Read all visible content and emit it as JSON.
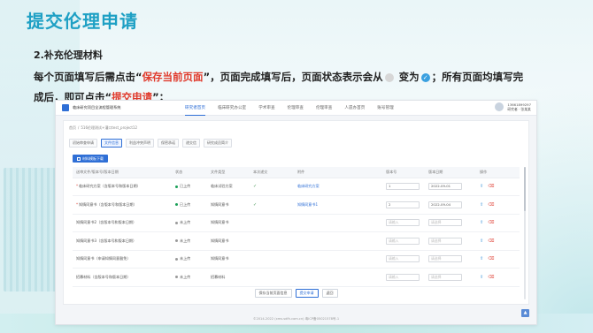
{
  "slide": {
    "title": "提交伦理申请",
    "section": "2.补充伦理材料",
    "p1": "每个页面填写后需点击“",
    "p1_hl": "保存当前页面",
    "p1_b": "”，页面完成填写后，页面状态表示会从",
    "p1_c": "变为",
    "p1_d": "；所有页面均填写完",
    "p2": "成后，即可点击“",
    "p2_hl": "提交申请",
    "p2_b": "”；"
  },
  "app": {
    "system_name": "临床研究项目全流程管理系统",
    "nav": [
      {
        "label": "研究者首页",
        "active": true
      },
      {
        "label": "临床研究办公室"
      },
      {
        "label": "学术审查"
      },
      {
        "label": "伦理审查"
      },
      {
        "label": "伦理审查"
      },
      {
        "label": "人遗办首页"
      },
      {
        "label": "账号管理"
      }
    ],
    "user_line1": "13661899297",
    "user_line2": "研究者 · 张某某",
    "breadcrumb": [
      "首页",
      "516伦理测试+灌口test_project12"
    ],
    "tabs": [
      {
        "label": "初始审查申请"
      },
      {
        "label": "文件信息",
        "active": true
      },
      {
        "label": "利益冲突声明"
      },
      {
        "label": "保密承诺"
      },
      {
        "label": "递交信"
      },
      {
        "label": "研究成员简介"
      }
    ],
    "download_button": "材料模板下载",
    "table": {
      "headers": [
        "送审文件/版本号/版本日期",
        "状态",
        "文件类型",
        "本次递交",
        "附件",
        "版本号",
        "版本日期",
        "操作"
      ],
      "rows": [
        {
          "name": "临床研究方案（含版本号和版本日期）",
          "required": true,
          "status": "已上传",
          "ok": true,
          "type": "临床试验方案",
          "submit": "✓",
          "attachment": "临床研究方案",
          "version": "1",
          "date": "2022-09-01"
        },
        {
          "name": "知情同意书（含版本号和版本日期）",
          "required": true,
          "status": "已上传",
          "ok": true,
          "type": "知情同意书",
          "submit": "✓",
          "attachment": "知情同意书1",
          "version": "2",
          "date": "2022-09-04"
        },
        {
          "name": "知情同意书2（含版本号和版本日期）",
          "required": false,
          "status": "未上传",
          "ok": false,
          "type": "知情同意书",
          "submit": "",
          "attachment": "",
          "version": "请输入",
          "date": "请选择"
        },
        {
          "name": "知情同意书3（含版本号和版本日期）",
          "required": false,
          "status": "未上传",
          "ok": false,
          "type": "知情同意书",
          "submit": "",
          "attachment": "",
          "version": "请输入",
          "date": "请选择"
        },
        {
          "name": "知情同意书（申请知情同意豁免）",
          "required": false,
          "status": "未上传",
          "ok": false,
          "type": "知情同意书",
          "submit": "",
          "attachment": "",
          "version": "请输入",
          "date": "请选择"
        },
        {
          "name": "招募材料（含版本号和版本日期）",
          "required": false,
          "status": "未上传",
          "ok": false,
          "type": "招募材料",
          "submit": "",
          "attachment": "",
          "version": "请输入",
          "date": "请选择"
        }
      ]
    },
    "actions": [
      "保存当前页面信息",
      "提交申请",
      "返回"
    ],
    "footer": "©2014-2022 (xms.sdfh.com.cn) 粤ICP备05021578号-1"
  },
  "colors": {
    "title": "#1ea0c4",
    "highlight": "#e03a2c",
    "primary": "#2f6fd6"
  }
}
